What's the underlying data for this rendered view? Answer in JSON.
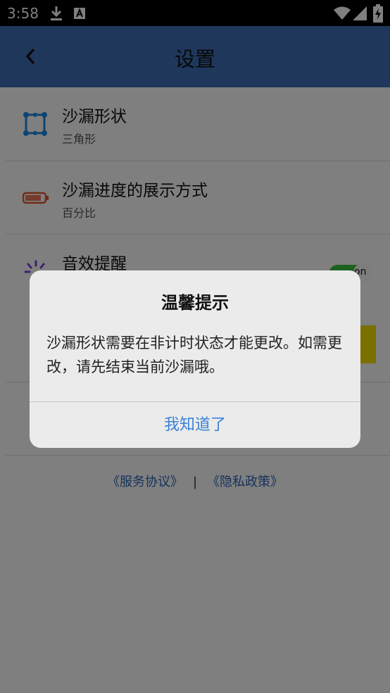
{
  "status_bar": {
    "time": "3:58"
  },
  "app_bar": {
    "title": "设置"
  },
  "settings": [
    {
      "title": "沙漏形状",
      "subtitle": "三角形",
      "icon": "hourglass-shape-icon"
    },
    {
      "title": "沙漏进度的展示方式",
      "subtitle": "百分比",
      "icon": "progress-battery-icon"
    },
    {
      "title": "音效提醒",
      "subtitle": "",
      "icon": "sound-icon",
      "toggle_label": "on"
    }
  ],
  "footer": {
    "service": "《服务协议》",
    "separator": "|",
    "privacy": "《隐私政策》"
  },
  "dialog": {
    "title": "温馨提示",
    "message": "沙漏形状需要在非计时状态才能更改。如需更改，请先结束当前沙漏哦。",
    "button": "我知道了"
  },
  "colors": {
    "app_bar": "#3f6fb6",
    "link": "#2d64b5",
    "dialog_button": "#3b82d6",
    "toggle_on": "#3cc33c",
    "accent_block": "#f3e000"
  }
}
